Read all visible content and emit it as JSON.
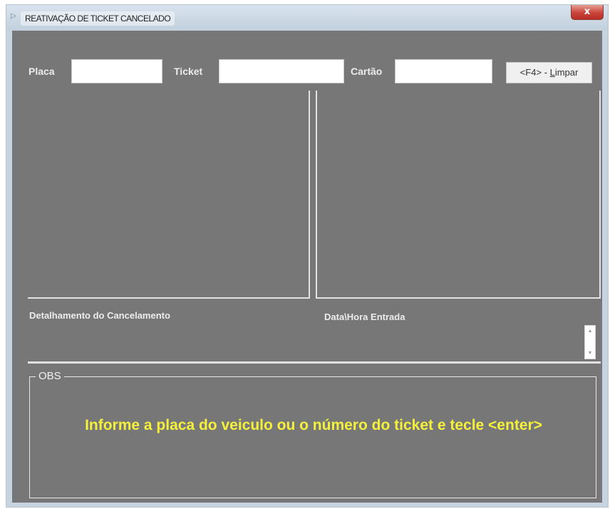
{
  "window": {
    "title": "REATIVAÇÃO DE TICKET CANCELADO",
    "title_icon": "▷",
    "close_label": "x"
  },
  "form": {
    "placa_label": "Placa",
    "placa_value": "",
    "ticket_label": "Ticket",
    "ticket_value": "",
    "cartao_label": "Cartão",
    "cartao_value": "",
    "limpar_shortcut": "<F4> - ",
    "limpar_accel": "L",
    "limpar_rest": "impar"
  },
  "labels": {
    "detalhamento": "Detalhamento do Cancelamento",
    "data_hora": "Data\\Hora Entrada"
  },
  "obs": {
    "legend": "OBS",
    "message": "Informe a placa do veiculo ou o número do ticket e tecle <enter>"
  },
  "colors": {
    "client_bg": "#777777",
    "message": "#f4f03c",
    "close_button": "#c8433a"
  },
  "icons": {
    "scroll_up": "▲",
    "scroll_down": "▼"
  }
}
